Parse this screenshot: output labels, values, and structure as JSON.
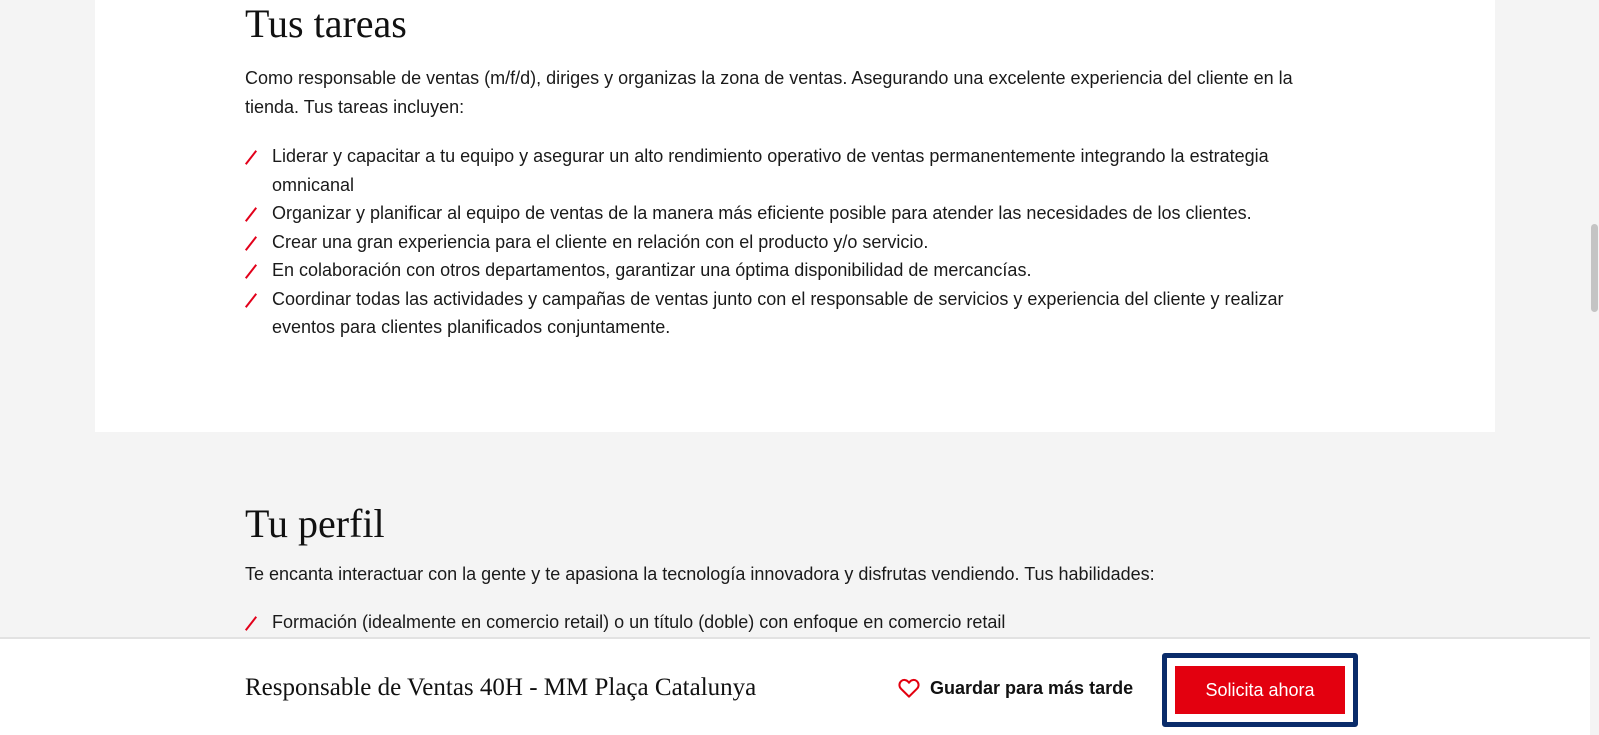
{
  "tareas": {
    "title": "Tus tareas",
    "intro": "Como responsable de ventas (m/f/d), diriges y organizas la zona de ventas. Asegurando una excelente experiencia del cliente en la tienda. Tus tareas incluyen:",
    "items": [
      "Liderar y capacitar a tu equipo y asegurar un alto rendimiento operativo de ventas permanentemente integrando la estrategia omnicanal",
      "Organizar y planificar al equipo de ventas de la manera más eficiente posible para atender las necesidades de los clientes.",
      "Crear una gran experiencia para el cliente en relación con el producto y/o servicio.",
      "En colaboración con otros departamentos, garantizar una óptima disponibilidad de mercancías.",
      "Coordinar todas las actividades y campañas de ventas junto con el responsable de servicios y experiencia del cliente y realizar eventos para clientes planificados conjuntamente."
    ]
  },
  "perfil": {
    "title": "Tu perfil",
    "intro": "Te encanta interactuar con la gente y te apasiona la tecnología innovadora y disfrutas vendiendo. Tus habilidades:",
    "items": [
      "Formación (idealmente en comercio retail) o un título (doble) con enfoque en comercio retail"
    ]
  },
  "sticky_bar": {
    "job_title": "Responsable de Ventas 40H - MM Plaça Catalunya",
    "save_label": "Guardar para más tarde",
    "save_icon": "heart-icon",
    "apply_label": "Solicita ahora"
  },
  "colors": {
    "accent_red": "#e3000f",
    "focus_outline": "#0a2c6a",
    "page_background": "#f4f4f4",
    "card_background": "#ffffff"
  }
}
